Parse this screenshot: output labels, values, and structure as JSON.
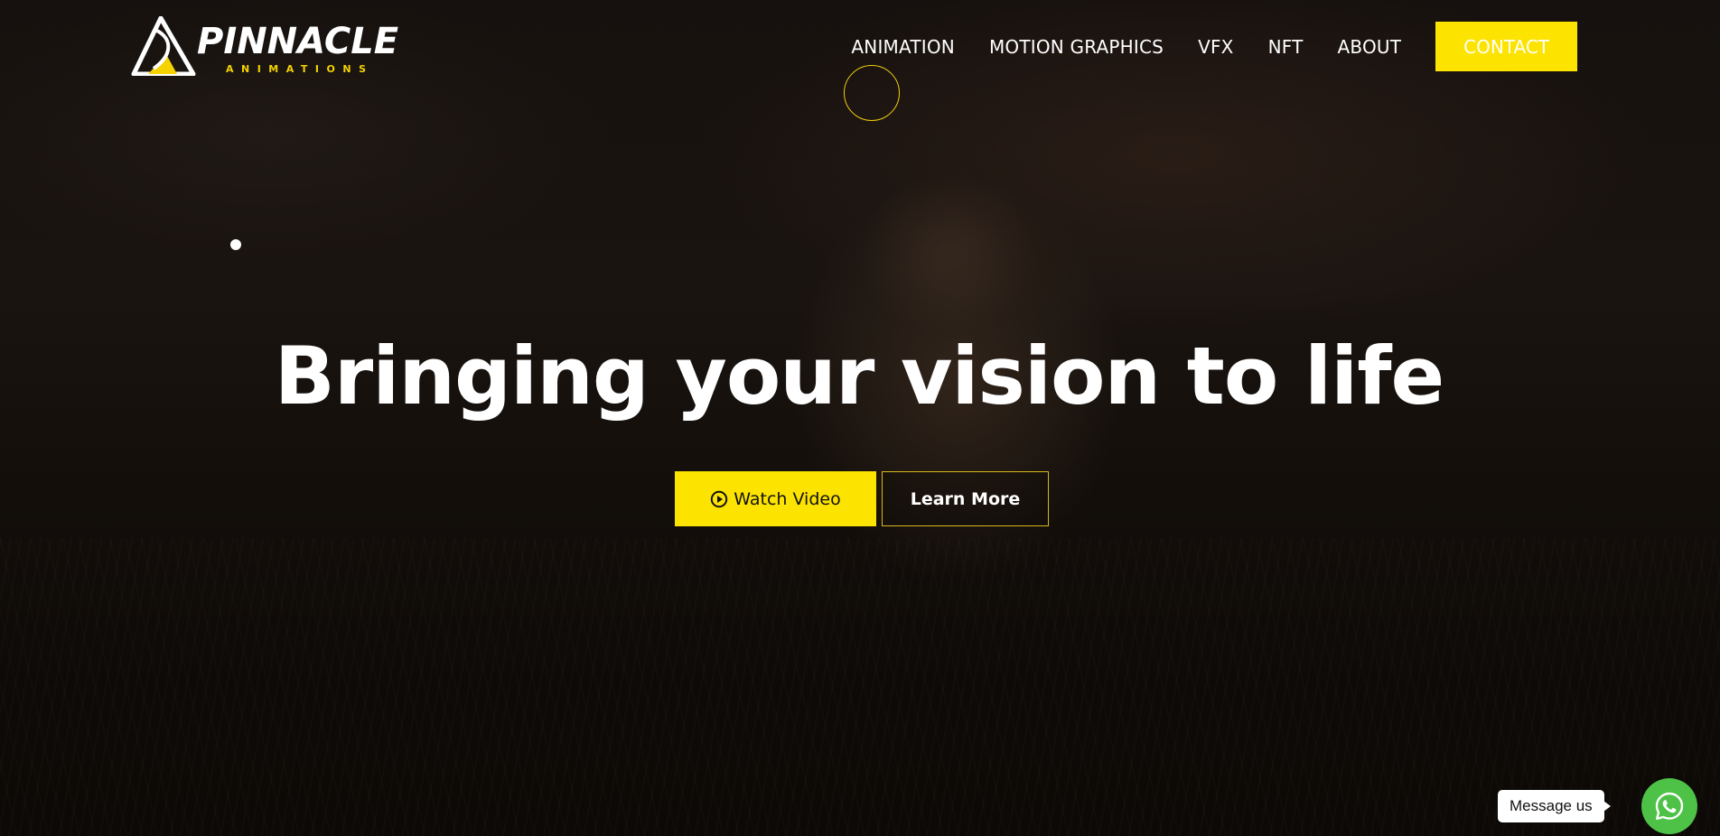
{
  "brand": {
    "name": "PINNACLE",
    "tagline": "ANIMATIONS",
    "accent_color": "#fce300"
  },
  "nav": {
    "items": [
      {
        "label": "ANIMATION"
      },
      {
        "label": "MOTION GRAPHICS"
      },
      {
        "label": "VFX"
      },
      {
        "label": "NFT"
      },
      {
        "label": "ABOUT"
      }
    ],
    "contact_label": "CONTACT"
  },
  "hero": {
    "headline": "Bringing your vision to life",
    "watch_label": "Watch Video",
    "watch_icon": "play-circle-icon",
    "learn_label": "Learn More"
  },
  "chat": {
    "bubble_text": "Message us",
    "icon": "whatsapp-icon",
    "color": "#4dc247"
  }
}
